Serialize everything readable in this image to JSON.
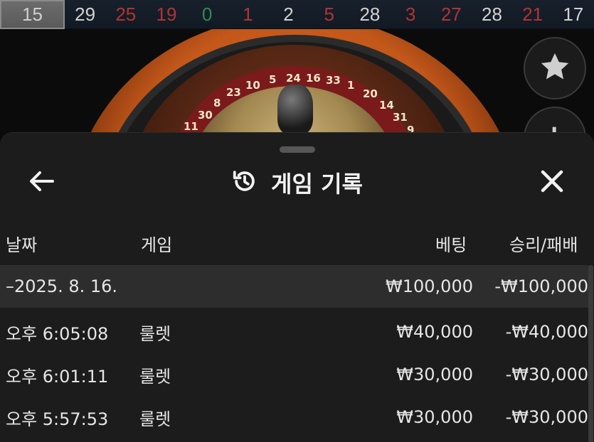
{
  "results_bar": {
    "latest": "15",
    "items": [
      {
        "value": "29",
        "color": "black"
      },
      {
        "value": "25",
        "color": "red"
      },
      {
        "value": "19",
        "color": "red"
      },
      {
        "value": "0",
        "color": "green"
      },
      {
        "value": "1",
        "color": "red"
      },
      {
        "value": "2",
        "color": "black"
      },
      {
        "value": "5",
        "color": "red"
      },
      {
        "value": "28",
        "color": "black"
      },
      {
        "value": "3",
        "color": "red"
      },
      {
        "value": "27",
        "color": "red"
      },
      {
        "value": "28",
        "color": "black"
      },
      {
        "value": "21",
        "color": "red"
      },
      {
        "value": "17",
        "color": "black"
      }
    ]
  },
  "wheel_numbers": [
    "11",
    "30",
    "8",
    "23",
    "10",
    "5",
    "24",
    "16",
    "33",
    "1",
    "20",
    "14",
    "31",
    "9"
  ],
  "side_buttons": {
    "favorite_icon": "star-icon",
    "stats_icon": "bar-chart-icon"
  },
  "sheet": {
    "title": "게임 기록",
    "title_icon": "history-icon",
    "back_icon": "arrow-left-icon",
    "close_icon": "close-icon"
  },
  "columns": {
    "date": "날짜",
    "game": "게임",
    "bet": "베팅",
    "win_loss": "승리/패배"
  },
  "date_group": {
    "label": "–2025. 8. 16.",
    "bet": "₩100,000",
    "result": "-₩100,000"
  },
  "rows": [
    {
      "time": "오후 6:05:08",
      "game": "룰렛",
      "bet": "₩40,000",
      "result": "-₩40,000"
    },
    {
      "time": "오후 6:01:11",
      "game": "룰렛",
      "bet": "₩30,000",
      "result": "-₩30,000"
    },
    {
      "time": "오후 5:57:53",
      "game": "룰렛",
      "bet": "₩30,000",
      "result": "-₩30,000"
    }
  ],
  "colors": {
    "sheet_bg": "#1c1c1c",
    "date_row_bg": "#2d2d2d",
    "result_red": "#b13434",
    "result_green": "#2e8b57",
    "text": "#e6e6e6"
  }
}
